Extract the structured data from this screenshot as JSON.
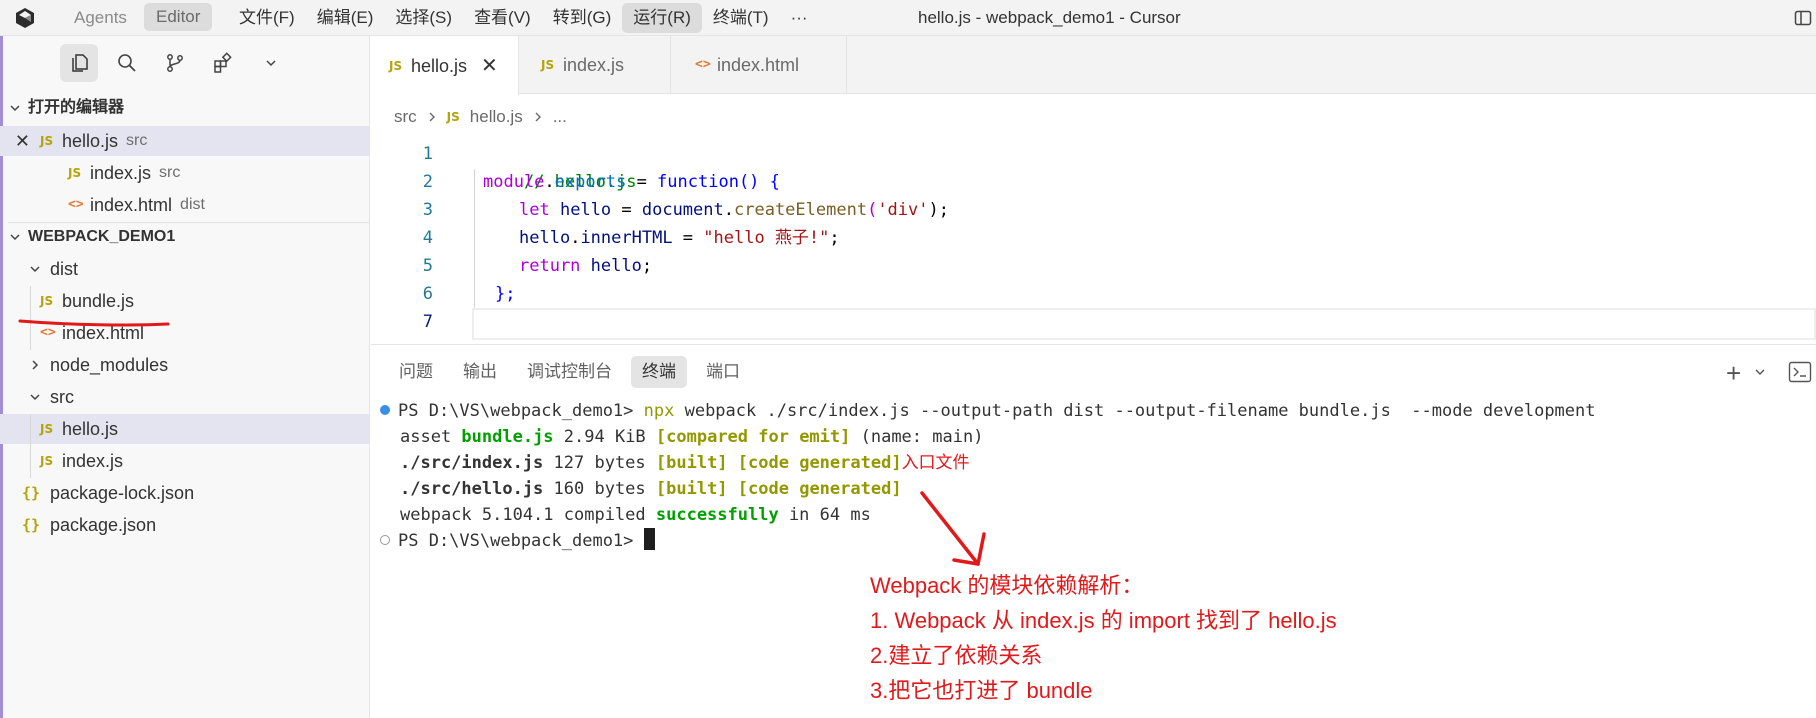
{
  "titlebar": {
    "agents": "Agents",
    "editor": "Editor",
    "menu": [
      "文件(F)",
      "编辑(E)",
      "选择(S)",
      "查看(V)",
      "转到(G)",
      "运行(R)",
      "终端(T)",
      "···"
    ],
    "window_title": "hello.js - webpack_demo1 - Cursor"
  },
  "sidebar": {
    "open_editors_title": "打开的编辑器",
    "open_editors": [
      {
        "name": "hello.js",
        "dir": "src",
        "icon": "js"
      },
      {
        "name": "index.js",
        "dir": "src",
        "icon": "js"
      },
      {
        "name": "index.html",
        "dir": "dist",
        "icon": "html"
      }
    ],
    "project_title": "WEBPACK_DEMO1",
    "tree": {
      "dist": "dist",
      "bundle": "bundle.js",
      "dist_index": "index.html",
      "node_modules": "node_modules",
      "src": "src",
      "hello": "hello.js",
      "index": "index.js",
      "lock": "package-lock.json",
      "pkg": "package.json"
    },
    "icons": {
      "js": "JS",
      "html": "<>",
      "json": "{}"
    }
  },
  "tabs": [
    {
      "label": "hello.js",
      "icon": "js",
      "active": true
    },
    {
      "label": "index.js",
      "icon": "js"
    },
    {
      "label": "index.html",
      "icon": "html"
    }
  ],
  "breadcrumb": {
    "folder": "src",
    "file": "hello.js",
    "more": "..."
  },
  "code": {
    "line_numbers": [
      "1",
      "2",
      "3",
      "4",
      "5",
      "6",
      "7"
    ],
    "l1": "// hello.js",
    "l2_module": "module",
    "l2_dot": ".",
    "l2_exports": "exports",
    "l2_eq": " = ",
    "l2_function": "function",
    "l2_tail": "() {",
    "l3_let": "let",
    "l3_hello": " hello",
    "l3_eq": " = ",
    "l3_document": "document",
    "l3_dot": ".",
    "l3_create": "createElement",
    "l3_open": "(",
    "l3_str": "'div'",
    "l3_close": ");",
    "l4_hello": "hello",
    "l4_dot": ".",
    "l4_inner": "innerHTML",
    "l4_eq": " = ",
    "l4_str": "\"hello 燕子!\"",
    "l4_semi": ";",
    "l5_return": "return",
    "l5_hello": " hello",
    "l5_semi": ";",
    "l6": "};"
  },
  "panel": {
    "tabs": [
      "问题",
      "输出",
      "调试控制台",
      "终端",
      "端口"
    ],
    "active_tab": "终端"
  },
  "terminal": {
    "prompt": "PS D:\\VS\\webpack_demo1> ",
    "cmd_npx": "npx",
    "cmd_rest": " webpack ./src/index.js --output-path dist --output-filename bundle.js  --mode development",
    "l2_asset": "asset ",
    "l2_file": "bundle.js",
    "l2_size": " 2.94 KiB ",
    "l2_flag": "[compared for emit]",
    "l2_name": " (name: main)",
    "l3_path": "./src/index.js",
    "l3_size": " 127 bytes ",
    "l3_built": "[built]",
    "l3_sp": " ",
    "l3_gen": "[code generated]",
    "l3_note": "入口文件",
    "l4_path": "./src/hello.js",
    "l4_size": " 160 bytes ",
    "l4_built": "[built]",
    "l4_sp": " ",
    "l4_gen": "[code generated]",
    "l5_pre": "webpack 5.104.1 compiled ",
    "l5_ok": "successfully",
    "l5_post": " in 64 ms",
    "prompt2": "PS D:\\VS\\webpack_demo1> "
  },
  "annotation": {
    "title": "Webpack 的模块依赖解析：",
    "line1": "1. Webpack 从 index.js 的 import 找到了 hello.js",
    "line2": "2.建立了依赖关系",
    "line3": "3.把它也打进了 bundle"
  },
  "colors": {
    "accent": "#a08fd6",
    "annotation": "#e0191b",
    "js_icon": "#b5a30a",
    "html_icon": "#e37933"
  }
}
